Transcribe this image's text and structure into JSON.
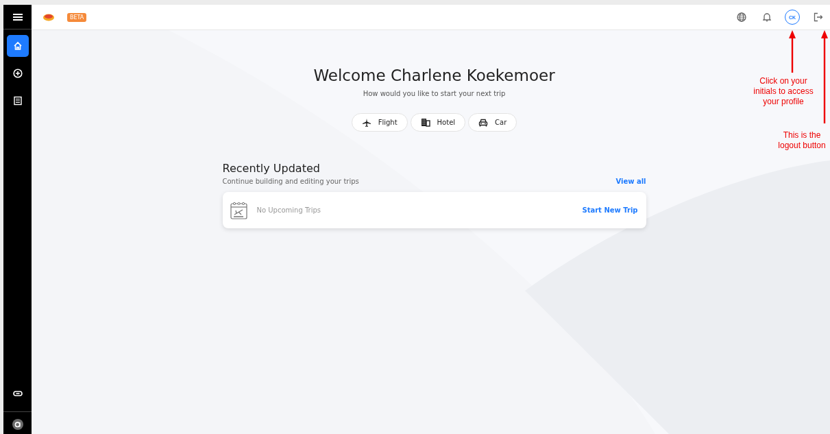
{
  "topbar": {
    "badge": "BETA",
    "avatar_initials": "CK"
  },
  "sidebar": {
    "items": [
      {
        "kind": "home",
        "selected": true
      },
      {
        "kind": "add",
        "selected": false
      },
      {
        "kind": "list",
        "selected": false
      }
    ]
  },
  "welcome": {
    "title": "Welcome Charlene Koekemoer",
    "subtitle": "How would you like to start your next trip"
  },
  "trip_types": [
    {
      "kind": "flight",
      "label": "Flight"
    },
    {
      "kind": "hotel",
      "label": "Hotel"
    },
    {
      "kind": "car",
      "label": "Car"
    }
  ],
  "recent": {
    "title": "Recently Updated",
    "subtitle": "Continue building and editing your trips",
    "view_all": "View all",
    "empty_text": "No Upcoming Trips",
    "action": "Start New Trip"
  },
  "annotations": [
    {
      "kind": "avatar",
      "text": "Click on your initials to access your profile"
    },
    {
      "kind": "logout",
      "text": "This is the logout button"
    }
  ]
}
